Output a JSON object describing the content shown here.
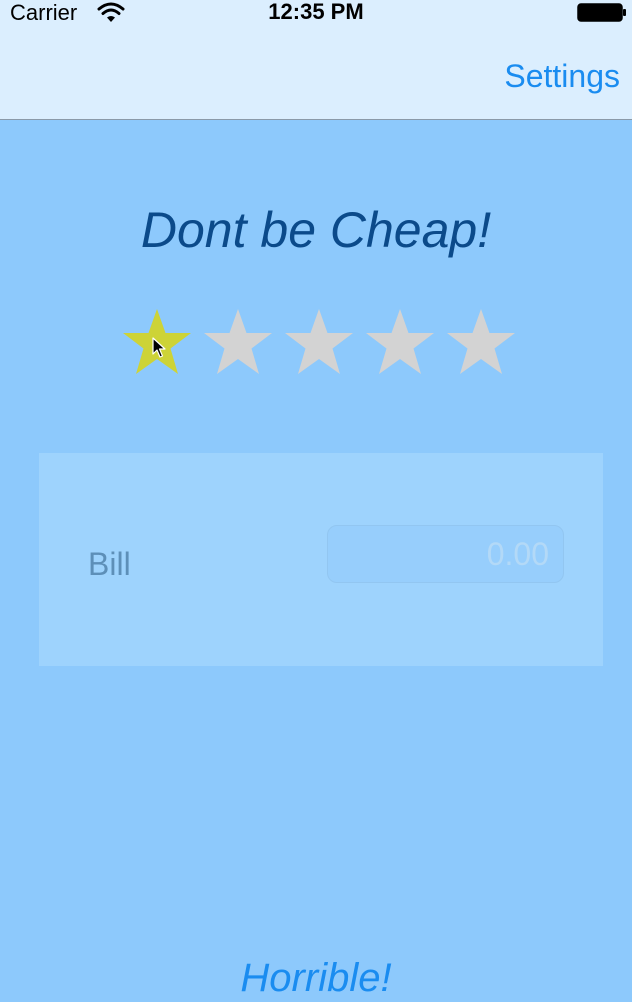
{
  "status_bar": {
    "carrier": "Carrier",
    "time": "12:35 PM",
    "wifi_icon": "wifi-icon",
    "battery_icon": "battery-icon"
  },
  "nav": {
    "settings_label": "Settings"
  },
  "headline": "Dont be Cheap!",
  "rating": {
    "value": 1,
    "max": 5,
    "filled_color": "#cdd337",
    "empty_color": "#d3d3d3",
    "star_icon": "star-icon"
  },
  "bill": {
    "label": "Bill",
    "placeholder": "0.00",
    "value": ""
  },
  "footer_label": "Horrible!",
  "colors": {
    "background": "#8dc9fc",
    "nav_background": "#dbeefe",
    "accent": "#1a8cf0",
    "headline": "#0b4a8a",
    "card": "#9ed3fd"
  }
}
